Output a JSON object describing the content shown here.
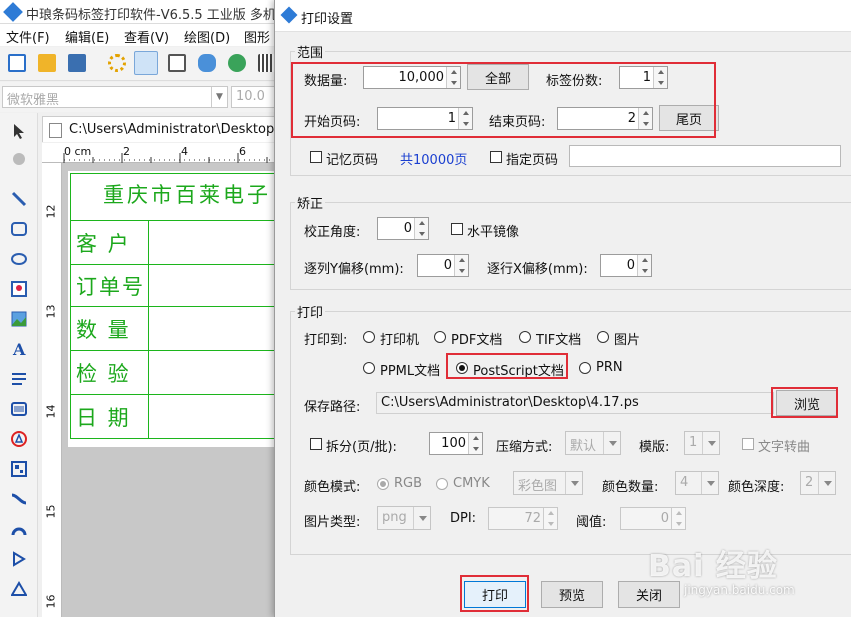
{
  "app": {
    "title": "中琅条码标签打印软件-V6.5.5 工业版 多机",
    "menu": [
      "文件(F)",
      "编辑(E)",
      "查看(V)",
      "绘图(D)",
      "图形"
    ],
    "font_name": "微软雅黑",
    "font_size": "10.0",
    "doc_tab": "C:\\Users\\Administrator\\Desktop\\",
    "ruler_h": [
      "0 cm",
      "2",
      "4",
      "6"
    ],
    "ruler_v": [
      "12",
      "13",
      "14",
      "15",
      "16"
    ],
    "label": {
      "title": "重庆市百莱电子",
      "rows": [
        "客 户",
        "订单号",
        "数 量",
        "检 验",
        "日 期"
      ]
    }
  },
  "dialog": {
    "title": "打印设置",
    "range": {
      "group_title": "范围",
      "data_count_label": "数据量:",
      "data_count": "10,000",
      "all_button": "全部",
      "copies_label": "标签份数:",
      "copies": "1",
      "start_page_label": "开始页码:",
      "start_page": "1",
      "end_page_label": "结束页码:",
      "end_page": "2",
      "last_page_button": "尾页",
      "remember_page": "记忆页码",
      "total_pages": "共10000页",
      "specify_page": "指定页码",
      "specify_page_value": ""
    },
    "correct": {
      "group_title": "矫正",
      "angle_label": "校正角度:",
      "angle": "0",
      "mirror": "水平镜像",
      "y_offset_label": "逐列Y偏移(mm):",
      "y_offset": "0",
      "x_offset_label": "逐行X偏移(mm):",
      "x_offset": "0"
    },
    "print": {
      "group_title": "打印",
      "print_to_label": "打印到:",
      "targets": [
        "打印机",
        "PDF文档",
        "TIF文档",
        "图片",
        "PPML文档",
        "PostScript文档",
        "PRN"
      ],
      "selected_target": "PostScript文档",
      "save_path_label": "保存路径:",
      "save_path": "C:\\Users\\Administrator\\Desktop\\4.17.ps",
      "browse_button": "浏览",
      "split_label": "拆分(页/批):",
      "split_value": "100",
      "compress_label": "压缩方式:",
      "compress_value": "默认",
      "template_label": "模版:",
      "template_value": "1",
      "text_to_curve": "文字转曲",
      "color_mode_label": "颜色模式:",
      "color_rgb": "RGB",
      "color_cmyk": "CMYK",
      "color_map": "彩色图",
      "color_count_label": "颜色数量:",
      "color_count": "4",
      "color_depth_label": "颜色深度:",
      "color_depth": "2",
      "image_type_label": "图片类型:",
      "image_type": "png",
      "dpi_label": "DPI:",
      "dpi": "72",
      "threshold_label": "阈值:",
      "threshold": "0"
    },
    "buttons": {
      "print": "打印",
      "preview": "预览",
      "close": "关闭"
    }
  },
  "watermark": {
    "main": "Bai 经验",
    "sub": "jingyan.baidu.com"
  },
  "colors": {
    "highlight_red": "#e02d37",
    "label_green": "#1ca81c",
    "total_pages_blue": "#1a3fd0"
  }
}
